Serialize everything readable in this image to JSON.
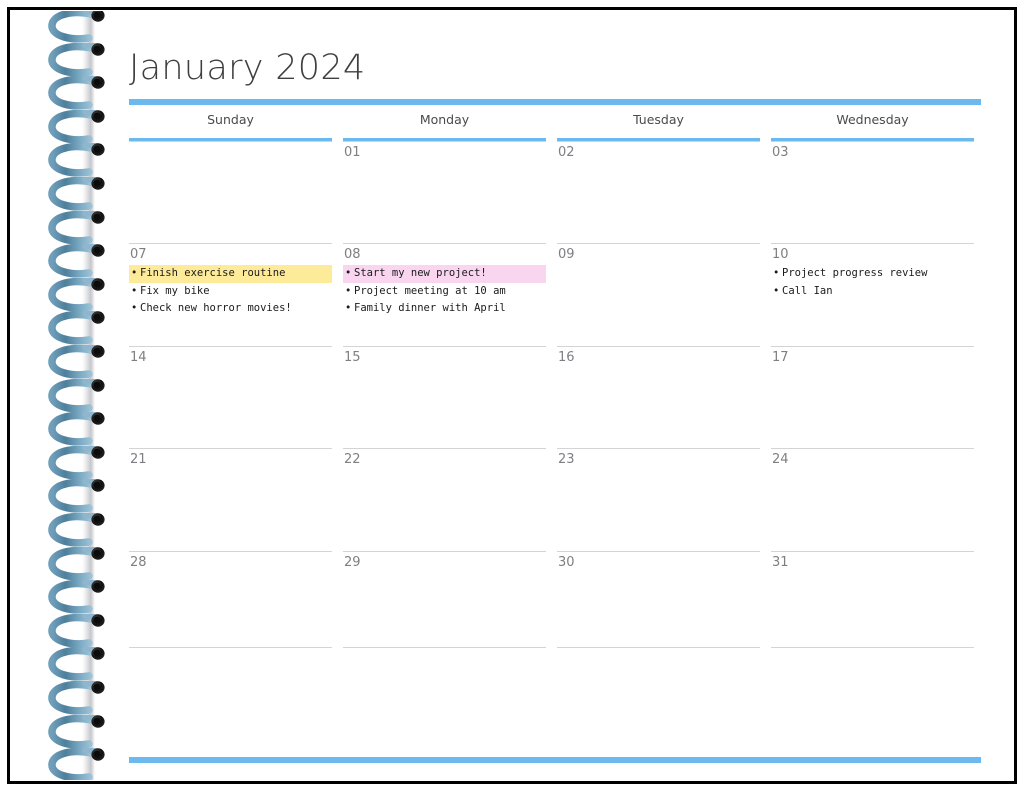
{
  "title": "January 2024",
  "theme": {
    "accent_blue": "#6cb9f0",
    "rule_gray": "#d4d4d4",
    "date_gray": "#7f7f83",
    "title_gray": "#3f3f42",
    "highlight_yellow": "#fdeb9a",
    "highlight_pink": "#f9d5f0",
    "coil_blue": "#5b8ca8",
    "border_black": "#000000"
  },
  "weekdays": [
    "Sunday",
    "Monday",
    "Tuesday",
    "Wednesday"
  ],
  "weeks": [
    [
      {
        "date": "",
        "events": []
      },
      {
        "date": "01",
        "events": []
      },
      {
        "date": "02",
        "events": []
      },
      {
        "date": "03",
        "events": []
      }
    ],
    [
      {
        "date": "07",
        "events": [
          {
            "text": "Finish exercise routine",
            "highlight": "yellow"
          },
          {
            "text": "Fix my bike",
            "highlight": "none"
          },
          {
            "text": "Check new horror movies!",
            "highlight": "none"
          }
        ]
      },
      {
        "date": "08",
        "events": [
          {
            "text": "Start my new project!",
            "highlight": "pink"
          },
          {
            "text": "Project meeting at 10 am",
            "highlight": "none"
          },
          {
            "text": "Family dinner with April",
            "highlight": "none"
          }
        ]
      },
      {
        "date": "09",
        "events": []
      },
      {
        "date": "10",
        "events": [
          {
            "text": "Project progress review",
            "highlight": "none"
          },
          {
            "text": "Call Ian",
            "highlight": "none"
          }
        ]
      }
    ],
    [
      {
        "date": "14",
        "events": []
      },
      {
        "date": "15",
        "events": []
      },
      {
        "date": "16",
        "events": []
      },
      {
        "date": "17",
        "events": []
      }
    ],
    [
      {
        "date": "21",
        "events": []
      },
      {
        "date": "22",
        "events": []
      },
      {
        "date": "23",
        "events": []
      },
      {
        "date": "24",
        "events": []
      }
    ],
    [
      {
        "date": "28",
        "events": []
      },
      {
        "date": "29",
        "events": []
      },
      {
        "date": "30",
        "events": []
      },
      {
        "date": "31",
        "events": []
      }
    ]
  ],
  "binding": {
    "coil_count": 23,
    "icon": "spiral-coil"
  },
  "bullet_glyph": "•"
}
